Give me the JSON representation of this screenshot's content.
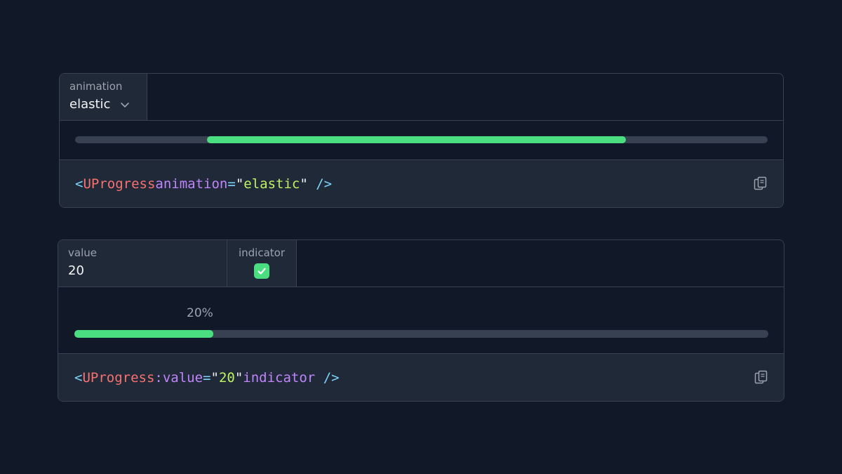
{
  "demo1": {
    "controls": [
      {
        "label": "animation",
        "value": "elastic"
      }
    ],
    "progress": {
      "animation": "elastic",
      "fill_start_fraction": 0.19,
      "fill_end_fraction": 0.795
    },
    "code": {
      "open": "<",
      "component": "UProgress",
      "attr": "animation",
      "eq": "=",
      "quote_open": "\"",
      "value": "elastic",
      "quote_close": "\"",
      "close": " />"
    }
  },
  "demo2": {
    "controls": [
      {
        "label": "value",
        "value": "20"
      },
      {
        "label": "indicator",
        "checked": true
      }
    ],
    "progress": {
      "value_percent": 20,
      "indicator_text": "20%"
    },
    "code": {
      "open": "<",
      "component": "UProgress",
      "attr": ":value",
      "eq": "=",
      "quote_open": "\"",
      "value": "20",
      "quote_close": "\"",
      "attr2": "indicator",
      "close": " />"
    }
  },
  "colors": {
    "background": "#111827",
    "panel": "#1f2937",
    "border": "#374151",
    "accent": "#4ade80"
  },
  "icons": {
    "chevron": "chevron-down-icon",
    "check": "check-icon",
    "copy": "clipboard-copy-icon"
  }
}
